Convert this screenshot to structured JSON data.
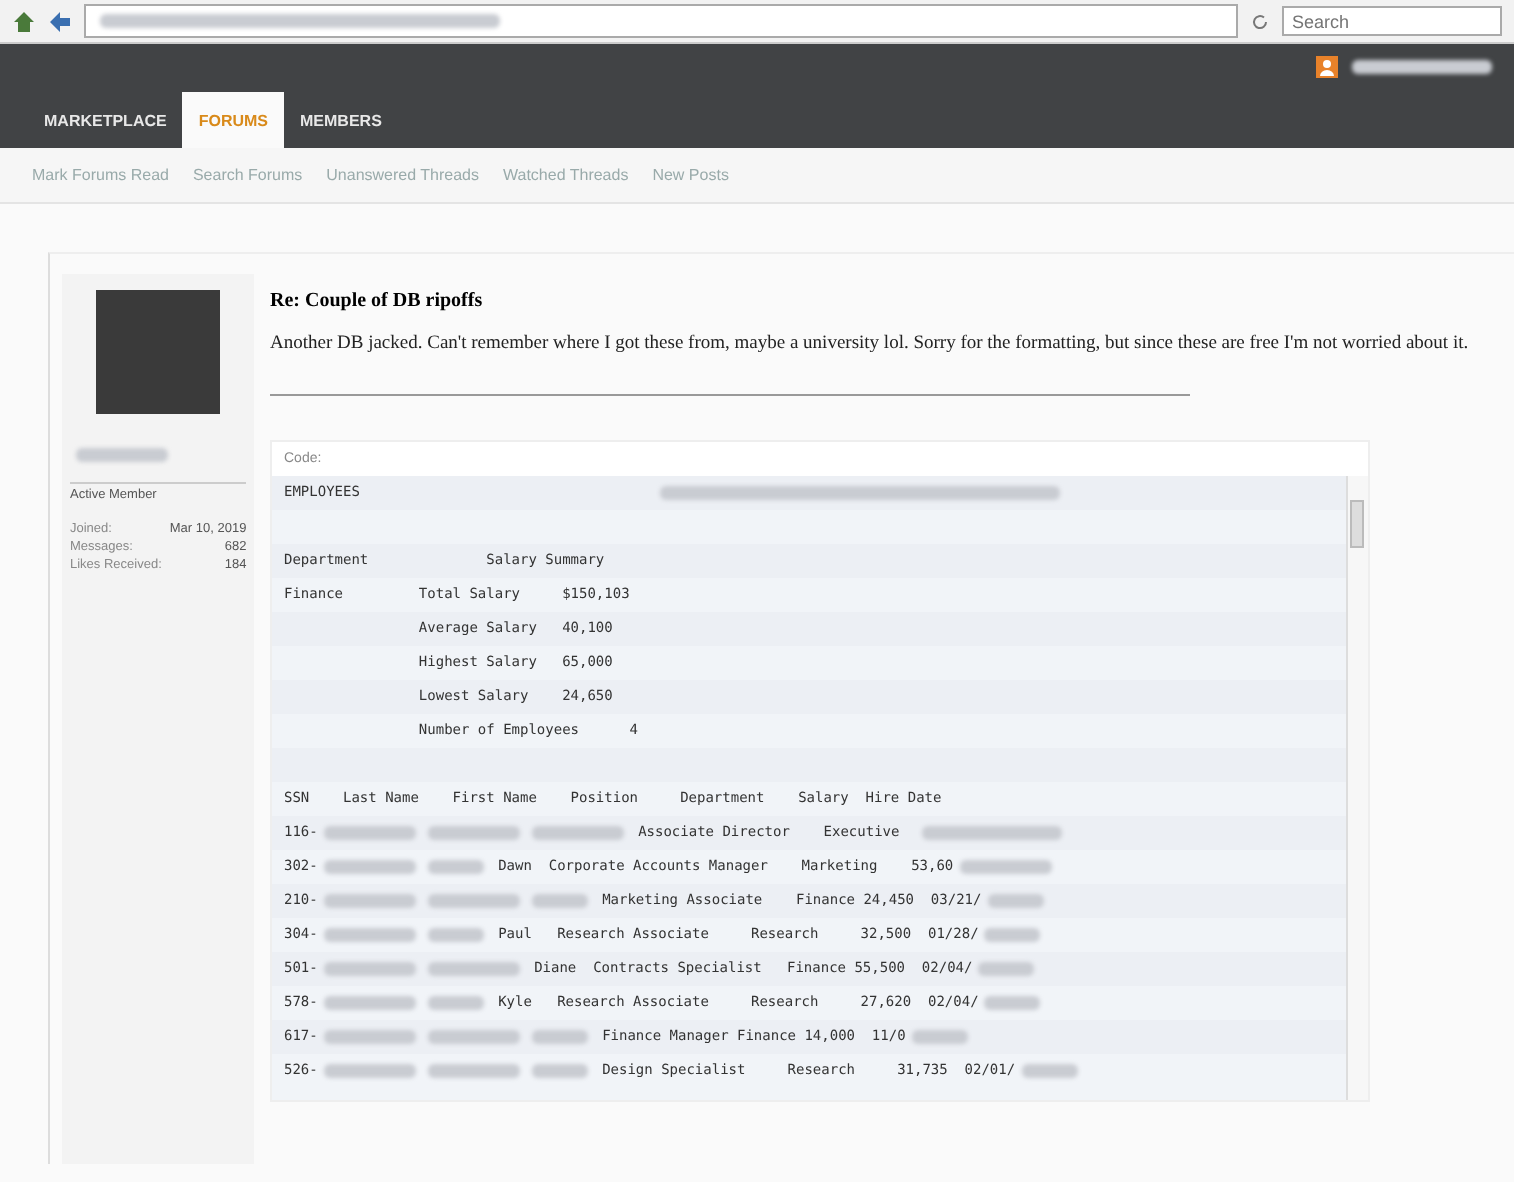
{
  "browser": {
    "search": {
      "placeholder": "Search"
    }
  },
  "tabs": [
    {
      "label": "MARKETPLACE",
      "selected": false
    },
    {
      "label": "FORUMS",
      "selected": true
    },
    {
      "label": "MEMBERS",
      "selected": false
    }
  ],
  "subnav": [
    "Mark Forums Read",
    "Search Forums",
    "Unanswered Threads",
    "Watched Threads",
    "New Posts"
  ],
  "profile": {
    "role": "Active Member",
    "stats": [
      {
        "label": "Joined:",
        "value": "Mar 10, 2019"
      },
      {
        "label": "Messages:",
        "value": "682"
      },
      {
        "label": "Likes Received:",
        "value": "184"
      }
    ]
  },
  "post": {
    "title": "Re: Couple of DB ripoffs",
    "body": "Another DB jacked. Can't remember where I got these from, maybe a university lol. Sorry for the formatting, but since these are free I'm not worried about it.",
    "code": {
      "label": "Code:",
      "lines": [
        {
          "kind": "content",
          "segments": [
            {
              "kind": "text",
              "text": "EMPLOYEES"
            },
            {
              "kind": "blur_far"
            }
          ]
        },
        {
          "kind": "blank"
        },
        {
          "kind": "content",
          "segments": [
            {
              "kind": "text",
              "text": "Department              Salary Summary"
            }
          ]
        },
        {
          "kind": "content",
          "segments": [
            {
              "kind": "text",
              "text": "Finance         Total Salary     $150,103"
            }
          ]
        },
        {
          "kind": "content",
          "segments": [
            {
              "kind": "text",
              "text": "                Average Salary   40,100"
            }
          ]
        },
        {
          "kind": "content",
          "segments": [
            {
              "kind": "text",
              "text": "                Highest Salary   65,000"
            }
          ]
        },
        {
          "kind": "content",
          "segments": [
            {
              "kind": "text",
              "text": "                Lowest Salary    24,650"
            }
          ]
        },
        {
          "kind": "content",
          "segments": [
            {
              "kind": "text",
              "text": "                Number of Employees      4"
            }
          ]
        },
        {
          "kind": "blank"
        },
        {
          "kind": "content",
          "segments": [
            {
              "kind": "text",
              "text": "SSN    Last Name    First Name    Position     Department    Salary  Hire Date"
            }
          ]
        },
        {
          "kind": "content",
          "segments": [
            {
              "kind": "text",
              "text": "116-"
            },
            {
              "kind": "blur_medium"
            },
            {
              "kind": "blur_medium"
            },
            {
              "kind": "blur_medium"
            },
            {
              "kind": "text",
              "text": " Associate Director    Executive  "
            },
            {
              "kind": "blur_long"
            }
          ]
        },
        {
          "kind": "content",
          "segments": [
            {
              "kind": "text",
              "text": "302-"
            },
            {
              "kind": "blur_medium"
            },
            {
              "kind": "blur_short"
            },
            {
              "kind": "text",
              "text": " Dawn  Corporate Accounts Manager    Marketing    53,60"
            },
            {
              "kind": "blur_medium"
            }
          ]
        },
        {
          "kind": "content",
          "segments": [
            {
              "kind": "text",
              "text": "210-"
            },
            {
              "kind": "blur_medium"
            },
            {
              "kind": "blur_medium"
            },
            {
              "kind": "blur_short"
            },
            {
              "kind": "text",
              "text": " Marketing Associate    Finance 24,450  03/21/"
            },
            {
              "kind": "blur_short"
            }
          ]
        },
        {
          "kind": "content",
          "segments": [
            {
              "kind": "text",
              "text": "304-"
            },
            {
              "kind": "blur_medium"
            },
            {
              "kind": "blur_short"
            },
            {
              "kind": "text",
              "text": " Paul   Research Associate     Research     32,500  01/28/"
            },
            {
              "kind": "blur_short"
            }
          ]
        },
        {
          "kind": "content",
          "segments": [
            {
              "kind": "text",
              "text": "501-"
            },
            {
              "kind": "blur_medium"
            },
            {
              "kind": "blur_medium"
            },
            {
              "kind": "text",
              "text": " Diane  Contracts Specialist   Finance 55,500  02/04/"
            },
            {
              "kind": "blur_short"
            }
          ]
        },
        {
          "kind": "content",
          "segments": [
            {
              "kind": "text",
              "text": "578-"
            },
            {
              "kind": "blur_medium"
            },
            {
              "kind": "blur_short"
            },
            {
              "kind": "text",
              "text": " Kyle   Research Associate     Research     27,620  02/04/"
            },
            {
              "kind": "blur_short"
            }
          ]
        },
        {
          "kind": "content",
          "segments": [
            {
              "kind": "text",
              "text": "617-"
            },
            {
              "kind": "blur_medium"
            },
            {
              "kind": "blur_medium"
            },
            {
              "kind": "blur_short"
            },
            {
              "kind": "text",
              "text": " Finance Manager Finance 14,000  11/0"
            },
            {
              "kind": "blur_short"
            }
          ]
        },
        {
          "kind": "content",
          "segments": [
            {
              "kind": "text",
              "text": "526-"
            },
            {
              "kind": "blur_medium"
            },
            {
              "kind": "blur_medium"
            },
            {
              "kind": "blur_short"
            },
            {
              "kind": "text",
              "text": " Design Specialist     Research     31,735  02/01/"
            },
            {
              "kind": "blur_short"
            }
          ]
        }
      ]
    }
  }
}
